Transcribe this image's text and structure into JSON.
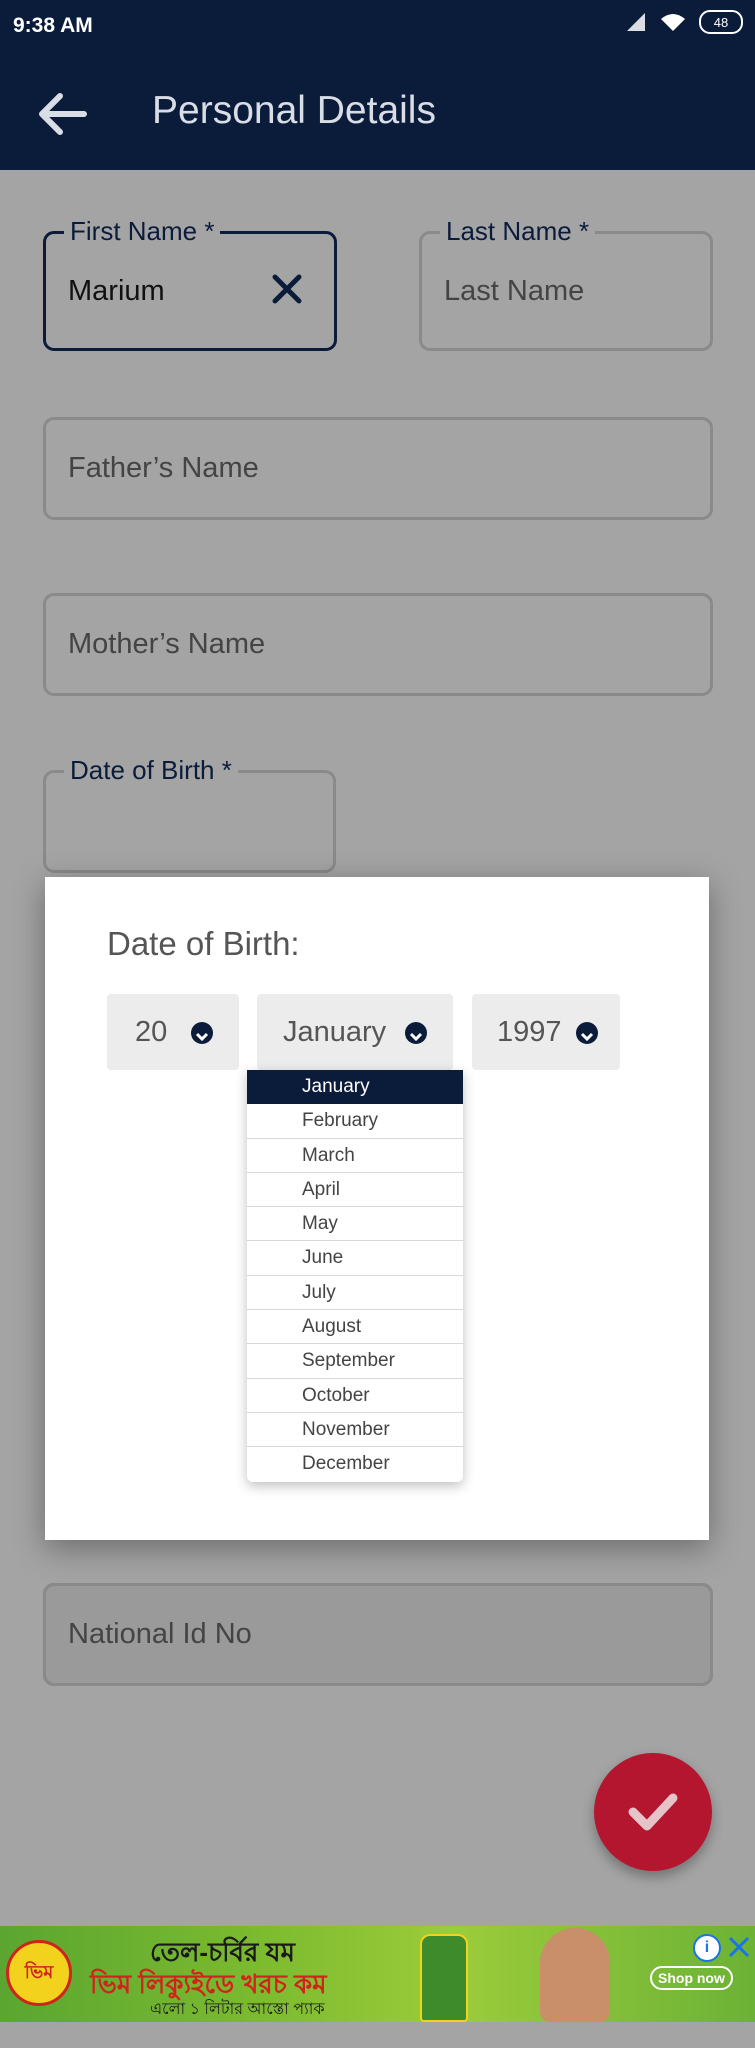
{
  "status_bar": {
    "time": "9:38 AM",
    "battery": "48"
  },
  "app_bar": {
    "title": "Personal Details"
  },
  "form": {
    "first_name": {
      "label": "First Name *",
      "value": "Marium"
    },
    "last_name": {
      "label": "Last Name *",
      "placeholder": "Last Name"
    },
    "fathers_name": {
      "placeholder": "Father’s Name"
    },
    "mothers_name": {
      "placeholder": "Mother’s Name"
    },
    "dob": {
      "label": "Date of Birth *"
    },
    "national_id": {
      "placeholder": "National Id No"
    }
  },
  "dob_dialog": {
    "title": "Date of Birth:",
    "day": "20",
    "month": "January",
    "year": "1997",
    "months": [
      "January",
      "February",
      "March",
      "April",
      "May",
      "June",
      "July",
      "August",
      "September",
      "October",
      "November",
      "December"
    ]
  },
  "ad": {
    "headline": "তেল-চর্বির যম",
    "line2": "ভিম লিক্যুইডে খরচ কম",
    "line3": "এলো ১ লিটার আস্তো প্যাক",
    "cta": "Shop now",
    "brand": "ভিম"
  },
  "colors": {
    "primary": "#0b1c3b",
    "accent": "#b3162e",
    "scrim": "#a4a4a4"
  }
}
